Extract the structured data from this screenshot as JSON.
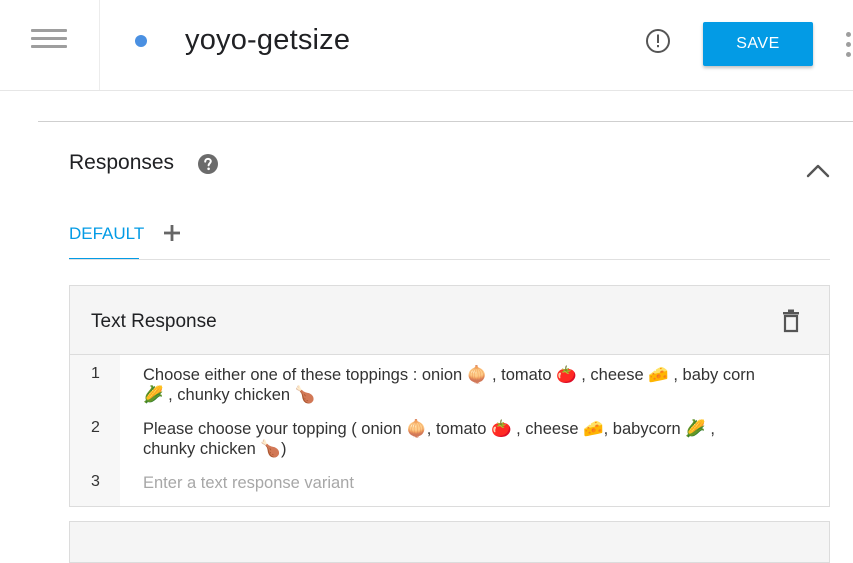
{
  "header": {
    "intent_name": "yoyo-getsize",
    "save_label": "SAVE",
    "colors": {
      "accent": "#039be5",
      "status_dot": "#4a90e2"
    }
  },
  "section": {
    "title": "Responses",
    "tabs": [
      {
        "label": "DEFAULT",
        "active": true
      }
    ]
  },
  "card": {
    "title": "Text Response",
    "rows": [
      {
        "num": "1",
        "text": "Choose either one of these toppings : onion 🧅 , tomato 🍅  , cheese 🧀 , baby corn 🌽 , chunky chicken 🍗"
      },
      {
        "num": "2",
        "text": "Please choose your topping ( onion 🧅, tomato 🍅 , cheese 🧀, babycorn 🌽 , chunky chicken 🍗)"
      },
      {
        "num": "3",
        "text": ""
      }
    ],
    "placeholder": "Enter a text response variant"
  }
}
